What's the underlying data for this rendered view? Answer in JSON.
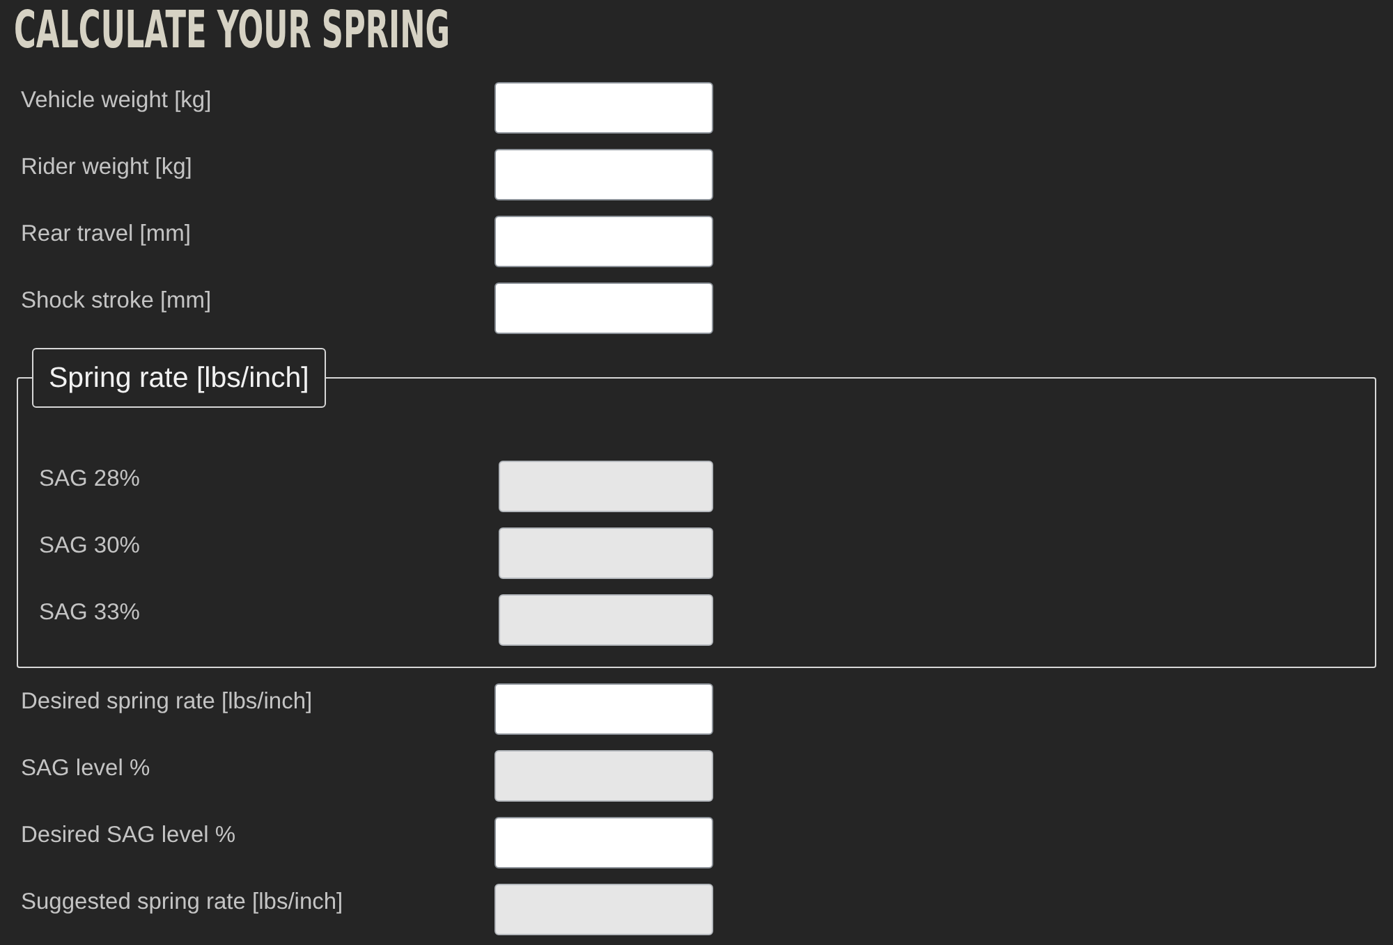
{
  "title": "CALCULATE YOUR SPRING",
  "inputs": [
    {
      "label": "Vehicle weight [kg]",
      "readonly": false
    },
    {
      "label": "Rider weight [kg]",
      "readonly": false
    },
    {
      "label": "Rear travel [mm]",
      "readonly": false
    },
    {
      "label": "Shock stroke [mm]",
      "readonly": false
    }
  ],
  "spring_rate": {
    "legend": "Spring rate [lbs/inch]",
    "outputs": [
      {
        "label": "SAG 28%",
        "readonly": true
      },
      {
        "label": "SAG 30%",
        "readonly": true
      },
      {
        "label": "SAG 33%",
        "readonly": true
      }
    ]
  },
  "desired": [
    {
      "label": "Desired spring rate [lbs/inch]",
      "readonly": false
    },
    {
      "label": "SAG level %",
      "readonly": true
    },
    {
      "label": "Desired SAG level %",
      "readonly": false
    },
    {
      "label": "Suggested spring rate [lbs/inch]",
      "readonly": true
    }
  ]
}
